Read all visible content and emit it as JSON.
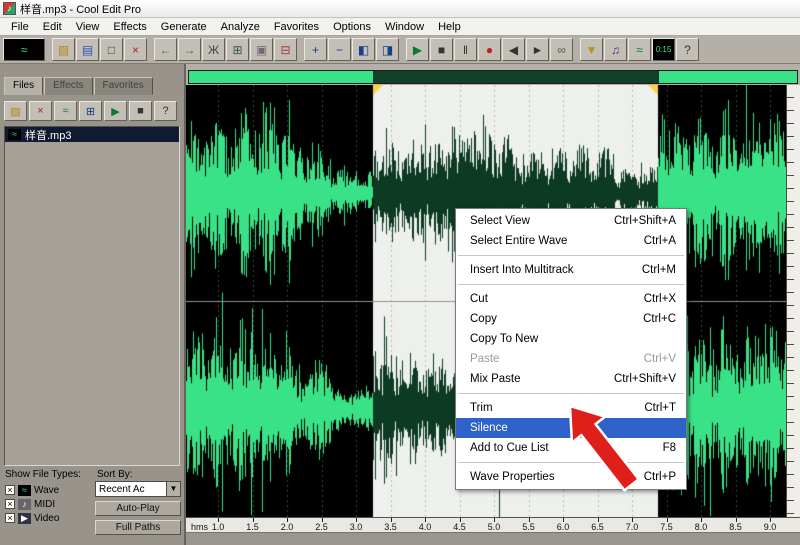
{
  "window": {
    "title": "样音.mp3 - Cool Edit Pro",
    "icon": "♪"
  },
  "menubar": {
    "items": [
      "File",
      "Edit",
      "View",
      "Effects",
      "Generate",
      "Analyze",
      "Favorites",
      "Options",
      "Window",
      "Help"
    ]
  },
  "toolbar": {
    "icons": [
      {
        "name": "waveform-multitrack-toggle-button",
        "glyph": "≈",
        "fg": "#3ae287",
        "bg": "#000000",
        "wide": true
      },
      {
        "sep": true
      },
      {
        "name": "open-file-button",
        "glyph": "▨",
        "fg": "#b58618"
      },
      {
        "name": "save-file-button",
        "glyph": "▤",
        "fg": "#2855b8"
      },
      {
        "name": "new-file-button",
        "glyph": "□",
        "fg": "#444444"
      },
      {
        "name": "close-file-button",
        "glyph": "×",
        "fg": "#b02020"
      },
      {
        "sep": true
      },
      {
        "name": "undo-button",
        "glyph": "←",
        "fg": "#1f7a2f"
      },
      {
        "name": "redo-button",
        "glyph": "→",
        "fg": "#1f7a2f"
      },
      {
        "name": "cut-button",
        "glyph": "Ж",
        "fg": "#444444"
      },
      {
        "name": "copy-button",
        "glyph": "⊞",
        "fg": "#335555"
      },
      {
        "name": "paste-button",
        "glyph": "▣",
        "fg": "#776677"
      },
      {
        "name": "trim-button",
        "glyph": "⊟",
        "fg": "#aa3333"
      },
      {
        "sep": true
      },
      {
        "name": "zoom-in-button",
        "glyph": "+",
        "fg": "#12408a"
      },
      {
        "name": "zoom-out-button",
        "glyph": "−",
        "fg": "#12408a"
      },
      {
        "name": "zoom-selection-button",
        "glyph": "◧",
        "fg": "#12408a"
      },
      {
        "name": "zoom-full-button",
        "glyph": "◨",
        "fg": "#12408a"
      },
      {
        "sep": true
      },
      {
        "name": "play-button",
        "glyph": "▶",
        "fg": "#0a7a30"
      },
      {
        "name": "stop-button",
        "glyph": "■",
        "fg": "#333333"
      },
      {
        "name": "pause-button",
        "glyph": "‖",
        "fg": "#333333"
      },
      {
        "name": "record-button",
        "glyph": "●",
        "fg": "#c02020"
      },
      {
        "name": "rewind-button",
        "glyph": "◀",
        "fg": "#333333"
      },
      {
        "name": "fast-forward-button",
        "glyph": "►",
        "fg": "#333333"
      },
      {
        "name": "loop-button",
        "glyph": "∞",
        "fg": "#555555"
      },
      {
        "sep": true
      },
      {
        "name": "marker-button",
        "glyph": "▼",
        "fg": "#b8941a"
      },
      {
        "name": "mixdown-button",
        "glyph": "♫",
        "fg": "#5a2a88"
      },
      {
        "name": "analyze-button",
        "glyph": "≈",
        "fg": "#0a7a30"
      },
      {
        "name": "time-display",
        "glyph": "0:15",
        "fg": "#3ae287",
        "bg": "#000000",
        "small": true
      },
      {
        "name": "help-button",
        "glyph": "?",
        "fg": "#333333"
      }
    ]
  },
  "file_panel": {
    "tabs": [
      {
        "label": "Files",
        "active": true
      },
      {
        "label": "Effects",
        "active": false
      },
      {
        "label": "Favorites",
        "active": false
      }
    ],
    "toolbar_icons": [
      {
        "name": "open-file-button",
        "glyph": "▨",
        "fg": "#b58618"
      },
      {
        "name": "close-file-button",
        "glyph": "×",
        "fg": "#b02020"
      },
      {
        "name": "edit-file-button",
        "glyph": "≈",
        "fg": "#1f7a2f"
      },
      {
        "name": "insert-multitrack-button",
        "glyph": "⊞",
        "fg": "#12408a"
      },
      {
        "name": "play-file-button",
        "glyph": "▶",
        "fg": "#0a7a30"
      },
      {
        "name": "stop-file-button",
        "glyph": "■",
        "fg": "#333333"
      },
      {
        "name": "help-button",
        "glyph": "?",
        "fg": "#333333"
      }
    ],
    "files": [
      {
        "name": "样音.mp3",
        "selected": true,
        "iconGlyph": "≈",
        "iconFg": "#3ae287",
        "iconBg": "#000000"
      }
    ],
    "footer": {
      "show_file_types_label": "Show File Types:",
      "sort_by_label": "Sort By:",
      "type_filters": [
        {
          "label": "Wave",
          "checked": true,
          "iconGlyph": "≈",
          "iconFg": "#3ae287",
          "iconBg": "#000000"
        },
        {
          "label": "MIDI",
          "checked": true,
          "iconGlyph": "♪",
          "iconFg": "#ffffff",
          "iconBg": "#666666"
        },
        {
          "label": "Video",
          "checked": true,
          "iconGlyph": "▶",
          "iconFg": "#ffffff",
          "iconBg": "#333344"
        }
      ],
      "sort_dropdown": {
        "value": "Recent Ac",
        "arrow_glyph": "▼"
      },
      "buttons": [
        "Auto-Play",
        "Full Paths"
      ]
    }
  },
  "context_menu": {
    "items": [
      {
        "label": "Select View",
        "shortcut": "Ctrl+Shift+A"
      },
      {
        "label": "Select Entire Wave",
        "shortcut": "Ctrl+A"
      },
      {
        "type": "sep"
      },
      {
        "label": "Insert Into Multitrack",
        "shortcut": "Ctrl+M"
      },
      {
        "type": "sep"
      },
      {
        "label": "Cut",
        "shortcut": "Ctrl+X"
      },
      {
        "label": "Copy",
        "shortcut": "Ctrl+C"
      },
      {
        "label": "Copy To New",
        "shortcut": ""
      },
      {
        "label": "Paste",
        "shortcut": "Ctrl+V",
        "disabled": true
      },
      {
        "label": "Mix Paste",
        "shortcut": "Ctrl+Shift+V"
      },
      {
        "type": "sep"
      },
      {
        "label": "Trim",
        "shortcut": "Ctrl+T"
      },
      {
        "label": "Silence",
        "shortcut": "",
        "highlighted": true
      },
      {
        "label": "Add to Cue List",
        "shortcut": "F8"
      },
      {
        "type": "sep"
      },
      {
        "label": "Wave Properties",
        "shortcut": "Ctrl+P"
      }
    ]
  },
  "timeline": {
    "unit_label": "hms",
    "ticks": [
      "1.0",
      "1.5",
      "2.0",
      "2.5",
      "3.0",
      "3.5",
      "4.0",
      "4.5",
      "5.0",
      "5.5",
      "6.0",
      "6.5",
      "7.0",
      "7.5",
      "8.0",
      "8.5",
      "9.0"
    ]
  },
  "colors": {
    "wave_green": "#3ae287",
    "wave_selected": "#0d3a23",
    "selection_bg": "#edf0ed",
    "menu_highlight": "#2f62c8",
    "arrow_red": "#df1f1a",
    "overview_green": "#3ae287",
    "overview_selected": "#123f28"
  }
}
